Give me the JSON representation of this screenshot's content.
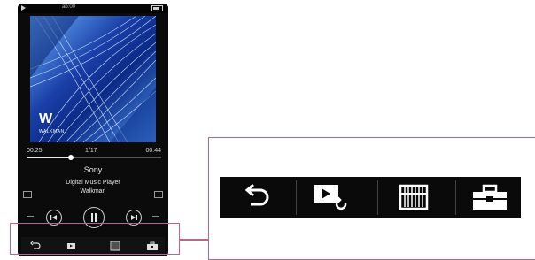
{
  "status_bar": {
    "time": "ab:00"
  },
  "track": {
    "elapsed": "00:25",
    "position": "1/17",
    "total": "00:44",
    "progress_fraction": 0.33,
    "artist": "Sony",
    "album": "Digital Music Player",
    "title": "Walkman"
  },
  "album_art": {
    "logo_mark": "W",
    "logo_word": "WALKMAN"
  },
  "icons": {
    "back": "back-arrow-icon",
    "play_queue": "play-queue-icon",
    "library": "library-icon",
    "options": "toolbox-icon"
  },
  "colors": {
    "highlight": "#b9658f",
    "bar": "#0a0a0a"
  }
}
